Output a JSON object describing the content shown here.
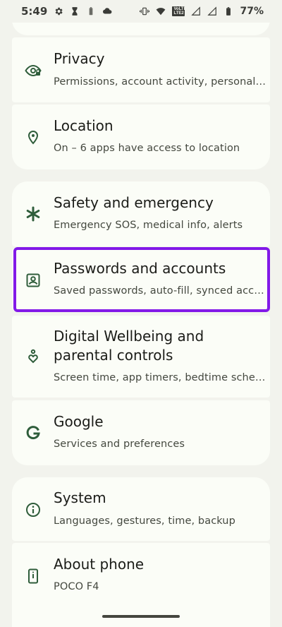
{
  "status_bar": {
    "time": "5:49",
    "battery_percent": "77%",
    "volte_line1": "VoLTE",
    "volte_line2": "LTE2"
  },
  "settings": {
    "privacy": {
      "title": "Privacy",
      "subtitle": "Permissions, account activity, personal data"
    },
    "location": {
      "title": "Location",
      "subtitle": "On – 6 apps have access to location"
    },
    "safety": {
      "title": "Safety and emergency",
      "subtitle": "Emergency SOS, medical info, alerts"
    },
    "passwords": {
      "title": "Passwords and accounts",
      "subtitle": "Saved passwords, auto-fill, synced accounts"
    },
    "wellbeing": {
      "title": "Digital Wellbeing and parental controls",
      "subtitle": "Screen time, app timers, bedtime schedules"
    },
    "google": {
      "title": "Google",
      "subtitle": "Services and preferences"
    },
    "system": {
      "title": "System",
      "subtitle": "Languages, gestures, time, backup"
    },
    "about": {
      "title": "About phone",
      "subtitle": "POCO F4"
    }
  },
  "colors": {
    "icon": "#2f5d3b",
    "highlight": "#8219e8",
    "card": "#fbfdf7",
    "background": "#f2f3ed"
  },
  "icons": {
    "privacy": "eye-lock-icon",
    "location": "location-pin-icon",
    "safety": "asterisk-icon",
    "passwords": "account-box-icon",
    "wellbeing": "wellbeing-heart-icon",
    "google": "google-g-icon",
    "system": "info-circle-icon",
    "about": "phone-icon"
  }
}
